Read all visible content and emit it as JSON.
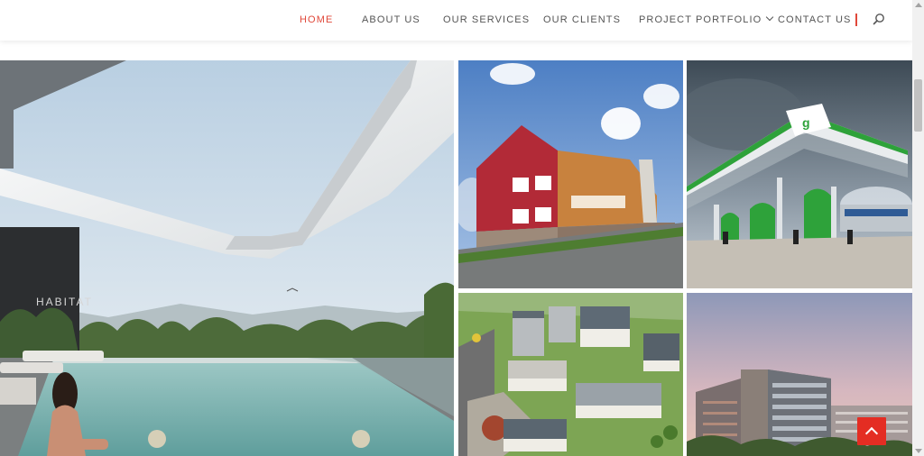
{
  "nav": {
    "items": [
      {
        "label": "HOME",
        "active": true
      },
      {
        "label": "ABOUT US",
        "active": false
      },
      {
        "label": "OUR SERVICES",
        "active": false
      },
      {
        "label": "OUR CLIENTS",
        "active": false
      },
      {
        "label": "PROJECT PORTFOLIO",
        "active": false,
        "has_dropdown": true
      },
      {
        "label": "CONTACT US",
        "active": false
      }
    ],
    "search_icon": "search-icon",
    "accent_color": "#e0483a"
  },
  "hero": {
    "sign_text": "HABITAT"
  },
  "gallery": {
    "tiles": [
      {
        "name": "rooftop-pool-render"
      },
      {
        "name": "red-roof-building-photo"
      },
      {
        "name": "petrol-station-photo"
      },
      {
        "name": "campus-aerial-render"
      },
      {
        "name": "office-block-dusk-render"
      }
    ]
  },
  "scroll_to_top": {
    "icon": "chevron-up-icon",
    "color": "#e42d23"
  }
}
